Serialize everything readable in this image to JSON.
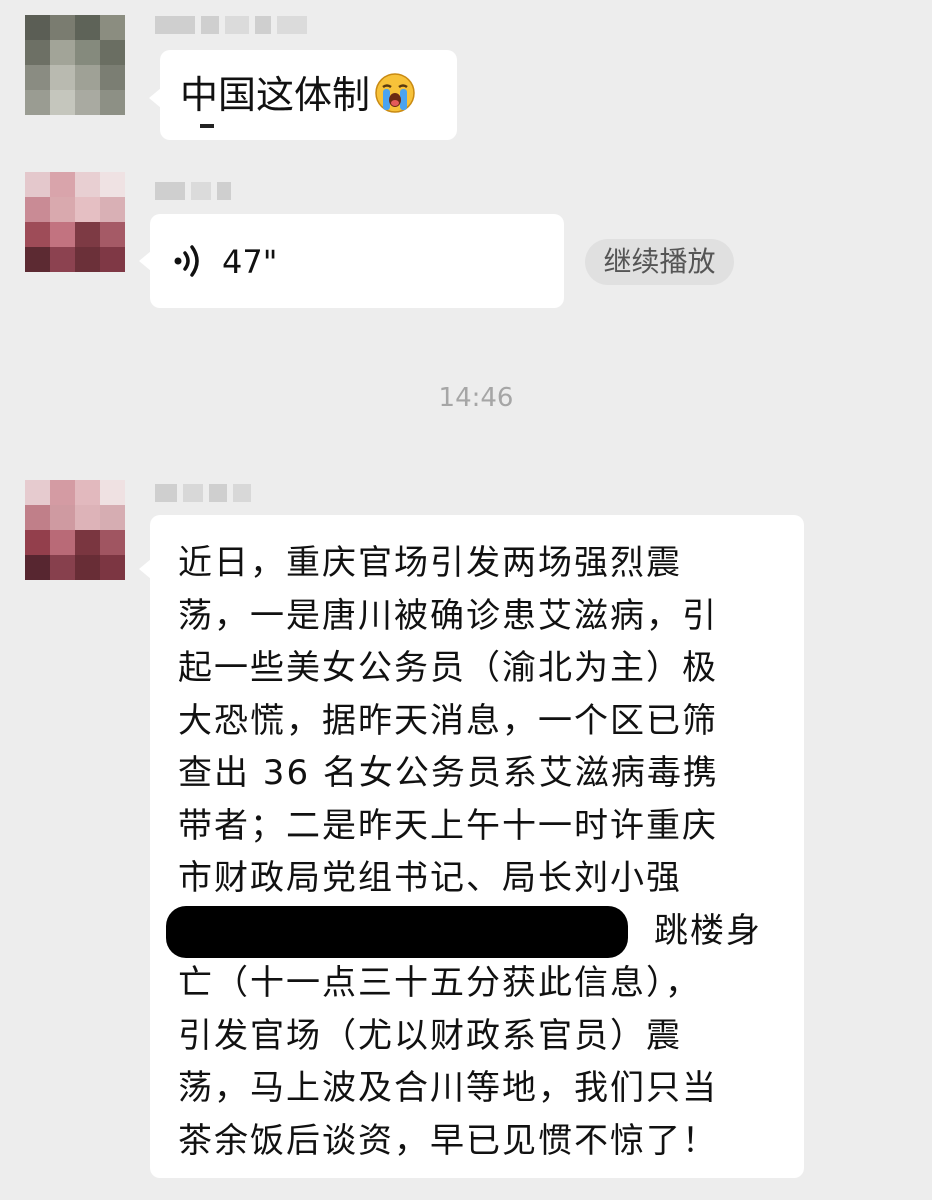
{
  "messages": [
    {
      "type": "text",
      "text": "中国这体制",
      "emoji": "loudly-crying-face-icon"
    },
    {
      "type": "voice",
      "duration": "47\"",
      "action_label": "继续播放"
    },
    {
      "type": "timestamp",
      "time": "14:46"
    },
    {
      "type": "text",
      "lines": [
        "近日，重庆官场引发两场强烈震",
        "荡，一是唐川被确诊患艾滋病，引",
        "起一些美女公务员（渝北为主）极",
        "大恐慌，据昨天消息，一个区已筛",
        "查出 36 名女公务员系艾滋病毒携",
        "带者；二是昨天上午十一时许重庆",
        "市财政局党组书记、局长刘小强",
        "跳楼身",
        "亡（十一点三十五分获此信息），",
        "引发官场（尤以财政系官员）震",
        "荡，马上波及合川等地，我们只当",
        "茶余饭后谈资，早已见惯不惊了！"
      ]
    }
  ],
  "colors": {
    "background": "#ededed",
    "bubble": "#ffffff",
    "timestamp": "#a6a6a6",
    "button_bg": "#e0e0e0"
  }
}
